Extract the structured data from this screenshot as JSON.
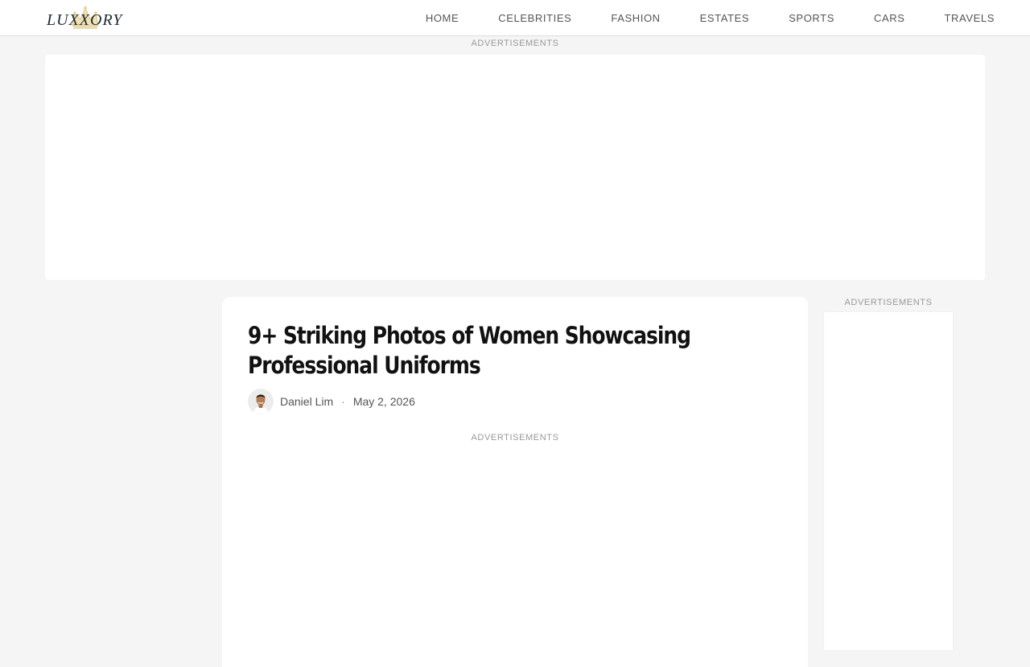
{
  "header": {
    "logo_text": "LUXXORY",
    "nav": [
      {
        "label": "HOME"
      },
      {
        "label": "CELEBRITIES"
      },
      {
        "label": "FASHION"
      },
      {
        "label": "ESTATES"
      },
      {
        "label": "SPORTS"
      },
      {
        "label": "CARS"
      },
      {
        "label": "TRAVELS"
      }
    ]
  },
  "ads": {
    "top_label": "ADVERTISEMENTS",
    "mid_label": "ADVERTISEMENTS",
    "sidebar_label": "ADVERTISEMENTS"
  },
  "article": {
    "title": "9+ Striking Photos of Women Showcasing Professional Uniforms",
    "author": "Daniel Lim",
    "separator": "·",
    "date": "May 2, 2026"
  },
  "colors": {
    "page_background": "#f5f5f5",
    "card_background": "#ffffff",
    "nav_text": "#555555",
    "title_text": "#111111"
  }
}
